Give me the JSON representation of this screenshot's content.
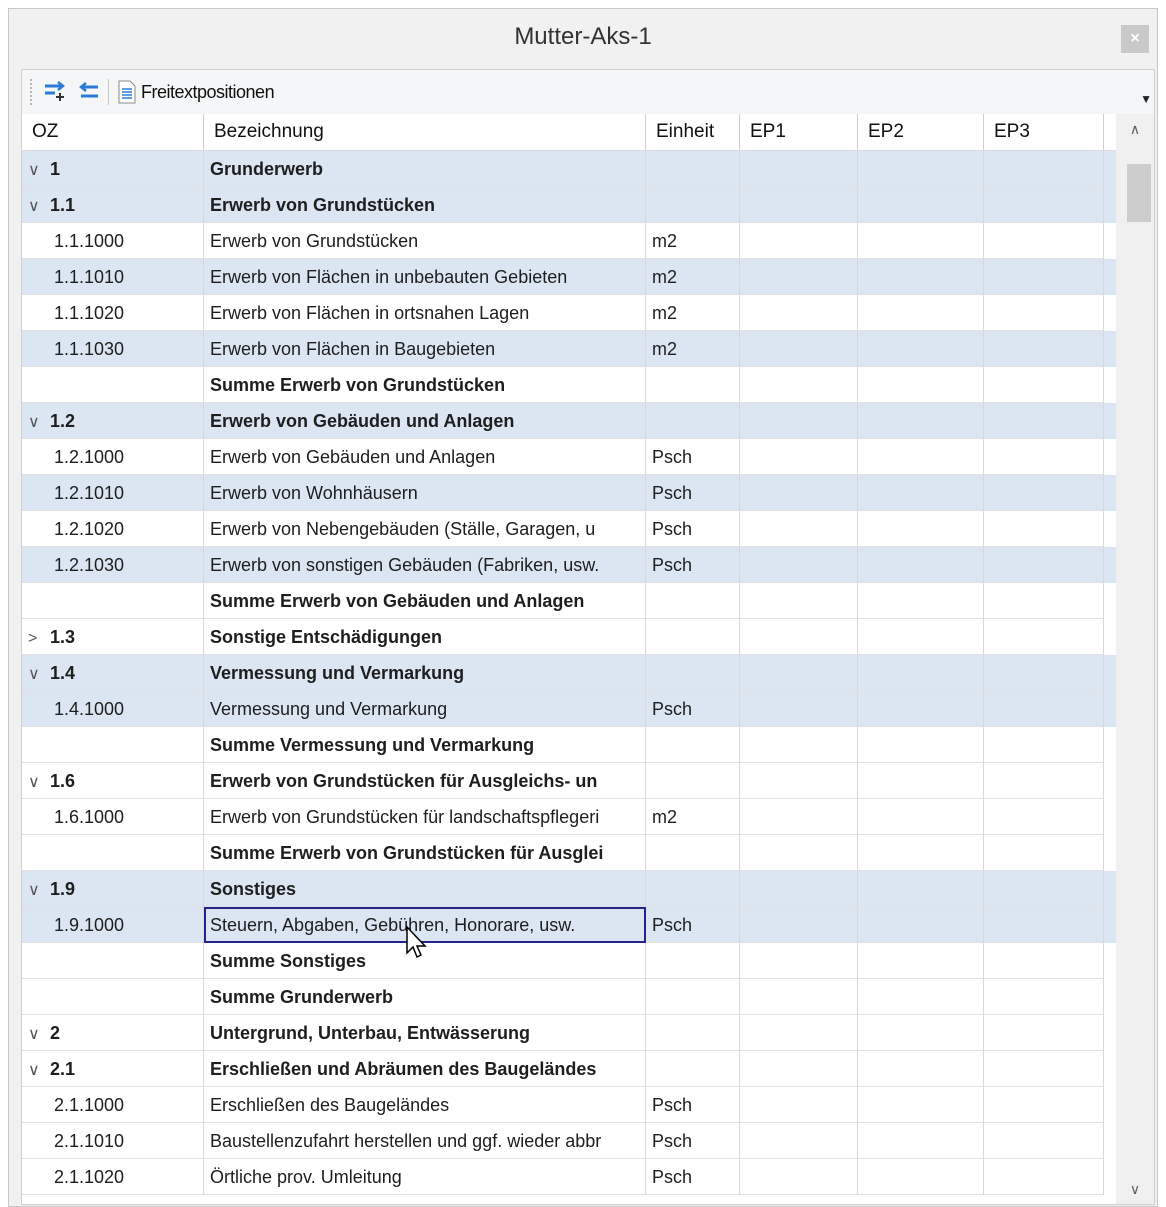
{
  "window": {
    "title": "Mutter-Aks-1"
  },
  "toolbar": {
    "freitext_label": "Freitextpositionen"
  },
  "columns": {
    "oz": "OZ",
    "bezeichnung": "Bezeichnung",
    "einheit": "Einheit",
    "ep1": "EP1",
    "ep2": "EP2",
    "ep3": "EP3"
  },
  "rows": [
    {
      "oz": "1",
      "bez": "Grunderwerb",
      "einheit": "",
      "exp": "∨"
    },
    {
      "oz": "1.1",
      "bez": "Erwerb von Grundstücken",
      "einheit": "",
      "exp": "∨"
    },
    {
      "oz": "1.1.1000",
      "bez": "Erwerb von Grundstücken",
      "einheit": "m2",
      "exp": ""
    },
    {
      "oz": "1.1.1010",
      "bez": "Erwerb von Flächen in unbebauten Gebieten",
      "einheit": "m2",
      "exp": ""
    },
    {
      "oz": "1.1.1020",
      "bez": "Erwerb von Flächen in ortsnahen Lagen",
      "einheit": "m2",
      "exp": ""
    },
    {
      "oz": "1.1.1030",
      "bez": "Erwerb von Flächen in Baugebieten",
      "einheit": "m2",
      "exp": ""
    },
    {
      "oz": "",
      "bez": "Summe Erwerb von Grundstücken",
      "einheit": "",
      "exp": ""
    },
    {
      "oz": "1.2",
      "bez": "Erwerb von Gebäuden und Anlagen",
      "einheit": "",
      "exp": "∨"
    },
    {
      "oz": "1.2.1000",
      "bez": "Erwerb von Gebäuden und Anlagen",
      "einheit": "Psch",
      "exp": ""
    },
    {
      "oz": "1.2.1010",
      "bez": "Erwerb von Wohnhäusern",
      "einheit": "Psch",
      "exp": ""
    },
    {
      "oz": "1.2.1020",
      "bez": "Erwerb von Nebengebäuden (Ställe, Garagen, u",
      "einheit": "Psch",
      "exp": ""
    },
    {
      "oz": "1.2.1030",
      "bez": "Erwerb von sonstigen Gebäuden (Fabriken, usw.",
      "einheit": "Psch",
      "exp": ""
    },
    {
      "oz": "",
      "bez": "Summe Erwerb von Gebäuden und Anlagen",
      "einheit": "",
      "exp": ""
    },
    {
      "oz": "1.3",
      "bez": "Sonstige Entschädigungen",
      "einheit": "",
      "exp": ">"
    },
    {
      "oz": "1.4",
      "bez": "Vermessung und Vermarkung",
      "einheit": "",
      "exp": "∨"
    },
    {
      "oz": "1.4.1000",
      "bez": "Vermessung und Vermarkung",
      "einheit": "Psch",
      "exp": ""
    },
    {
      "oz": "",
      "bez": "Summe Vermessung und Vermarkung",
      "einheit": "",
      "exp": ""
    },
    {
      "oz": "1.6",
      "bez": "Erwerb von Grundstücken für Ausgleichs- un",
      "einheit": "",
      "exp": "∨"
    },
    {
      "oz": "1.6.1000",
      "bez": "Erwerb von Grundstücken für landschaftspflegeri",
      "einheit": "m2",
      "exp": ""
    },
    {
      "oz": "",
      "bez": "Summe Erwerb von Grundstücken für Ausglei",
      "einheit": "",
      "exp": ""
    },
    {
      "oz": "1.9",
      "bez": "Sonstiges",
      "einheit": "",
      "exp": "∨"
    },
    {
      "oz": "1.9.1000",
      "bez": "Steuern, Abgaben, Gebühren, Honorare, usw.",
      "einheit": "Psch",
      "exp": ""
    },
    {
      "oz": "",
      "bez": "Summe Sonstiges",
      "einheit": "",
      "exp": ""
    },
    {
      "oz": "",
      "bez": "Summe Grunderwerb",
      "einheit": "",
      "exp": ""
    },
    {
      "oz": "2",
      "bez": "Untergrund, Unterbau, Entwässerung",
      "einheit": "",
      "exp": "∨"
    },
    {
      "oz": "2.1",
      "bez": "Erschließen und Abräumen des Baugeländes",
      "einheit": "",
      "exp": "∨"
    },
    {
      "oz": "2.1.1000",
      "bez": "Erschließen des Baugeländes",
      "einheit": "Psch",
      "exp": ""
    },
    {
      "oz": "2.1.1010",
      "bez": "Baustellenzufahrt herstellen und ggf. wieder abbr",
      "einheit": "Psch",
      "exp": ""
    },
    {
      "oz": "2.1.1020",
      "bez": "Örtliche prov. Umleitung",
      "einheit": "Psch",
      "exp": ""
    }
  ]
}
